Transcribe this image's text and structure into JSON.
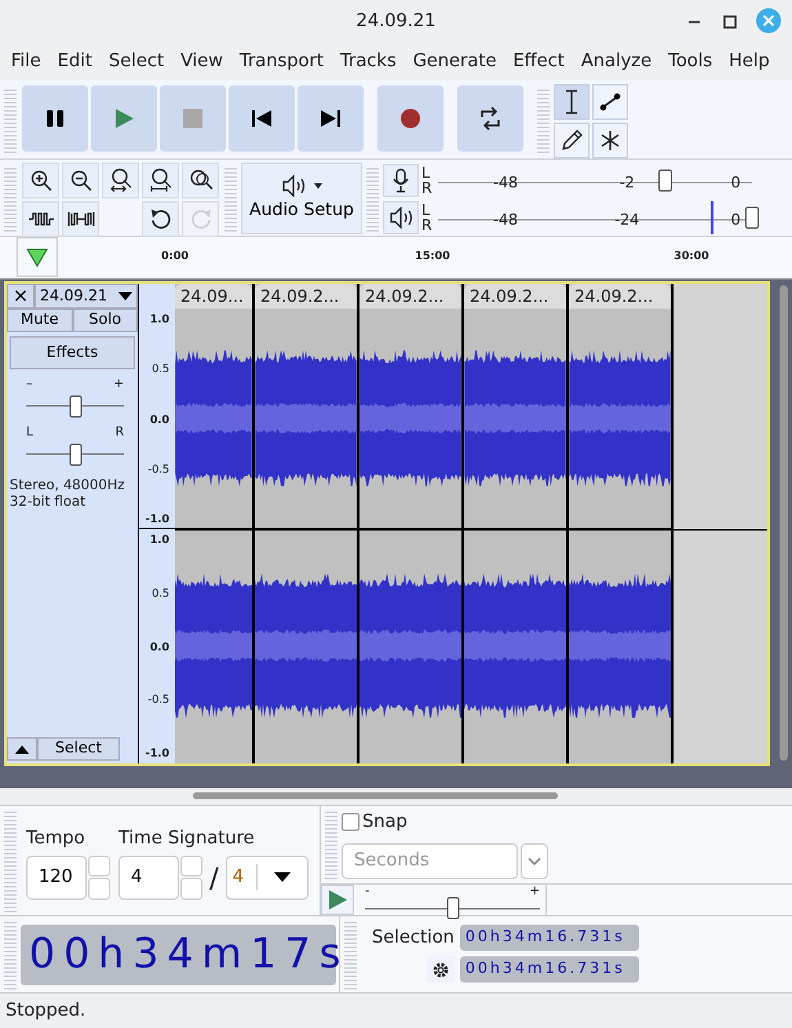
{
  "window": {
    "title": "24.09.21"
  },
  "menu": [
    "File",
    "Edit",
    "Select",
    "View",
    "Transport",
    "Tracks",
    "Generate",
    "Effect",
    "Analyze",
    "Tools",
    "Help"
  ],
  "transport": [
    {
      "kind": "pause"
    },
    {
      "kind": "play"
    },
    {
      "kind": "stop"
    },
    {
      "kind": "skip-start"
    },
    {
      "kind": "skip-end"
    },
    {
      "kind": "record"
    },
    {
      "kind": "loop"
    }
  ],
  "tools": [
    {
      "kind": "select",
      "selected": true
    },
    {
      "kind": "envelope",
      "selected": false
    },
    {
      "kind": "draw",
      "selected": false
    },
    {
      "kind": "multi",
      "selected": false
    }
  ],
  "zoom_buttons": [
    {
      "kind": "zoom-in",
      "disabled": false
    },
    {
      "kind": "zoom-out",
      "disabled": false
    },
    {
      "kind": "fit-selection",
      "disabled": false
    },
    {
      "kind": "fit-project",
      "disabled": false
    },
    {
      "kind": "zoom-toggle",
      "disabled": false
    }
  ],
  "cut_buttons": [
    {
      "kind": "trim",
      "disabled": false
    },
    {
      "kind": "silence",
      "disabled": false
    }
  ],
  "history_buttons": [
    {
      "kind": "undo",
      "disabled": false
    },
    {
      "kind": "redo",
      "disabled": true
    }
  ],
  "audio_setup": {
    "label": "Audio Setup"
  },
  "meters": [
    {
      "kind": "record",
      "channels": [
        "L",
        "R"
      ],
      "ticks": [
        "-48",
        "-2",
        "0"
      ],
      "level": 0.72
    },
    {
      "kind": "playback",
      "channels": [
        "L",
        "R"
      ],
      "ticks": [
        "-48",
        "-24",
        "0"
      ],
      "level": 0.99
    }
  ],
  "timeline": {
    "ticks": [
      "0:00",
      "15:00",
      "30:00"
    ]
  },
  "track": {
    "close_label": "×",
    "name": "24.09.21",
    "selected": true,
    "buttons": [
      "Mute",
      "Solo"
    ],
    "effects": "Effects",
    "gain": {
      "min_label": "–",
      "max_label": "+",
      "level": 0.5
    },
    "pan": {
      "min_label": "L",
      "max_label": "R",
      "level": 0.5
    },
    "info": [
      "Stereo, 48000Hz",
      "32-bit float"
    ],
    "select": "Select",
    "channels": [
      {
        "scale": [
          "1.0",
          "0.5",
          "0.0",
          "-0.5",
          "-1.0"
        ]
      },
      {
        "scale": [
          "1.0",
          "0.5",
          "0.0",
          "-0.5",
          "-1.0"
        ]
      }
    ],
    "clips": [
      {
        "name": "24.09..."
      },
      {
        "name": "24.09.2..."
      },
      {
        "name": "24.09.2..."
      },
      {
        "name": "24.09.2..."
      },
      {
        "name": "24.09.2..."
      }
    ]
  },
  "tempo": {
    "label": "Tempo",
    "value": "120"
  },
  "time_signature": {
    "label": "Time Signature",
    "upper": "4",
    "separator": "/",
    "lower": "4"
  },
  "snap": {
    "label": "Snap",
    "checked": false,
    "unit": "Seconds",
    "disabled": true
  },
  "play_at_speed": {
    "min_label": "-",
    "max_label": "+",
    "level": 0.5
  },
  "time": {
    "value": "00h34m17s"
  },
  "selection": {
    "label": "Selection",
    "start": "00h34m16.731s",
    "end": "00h34m16.731s"
  },
  "status": "Stopped."
}
